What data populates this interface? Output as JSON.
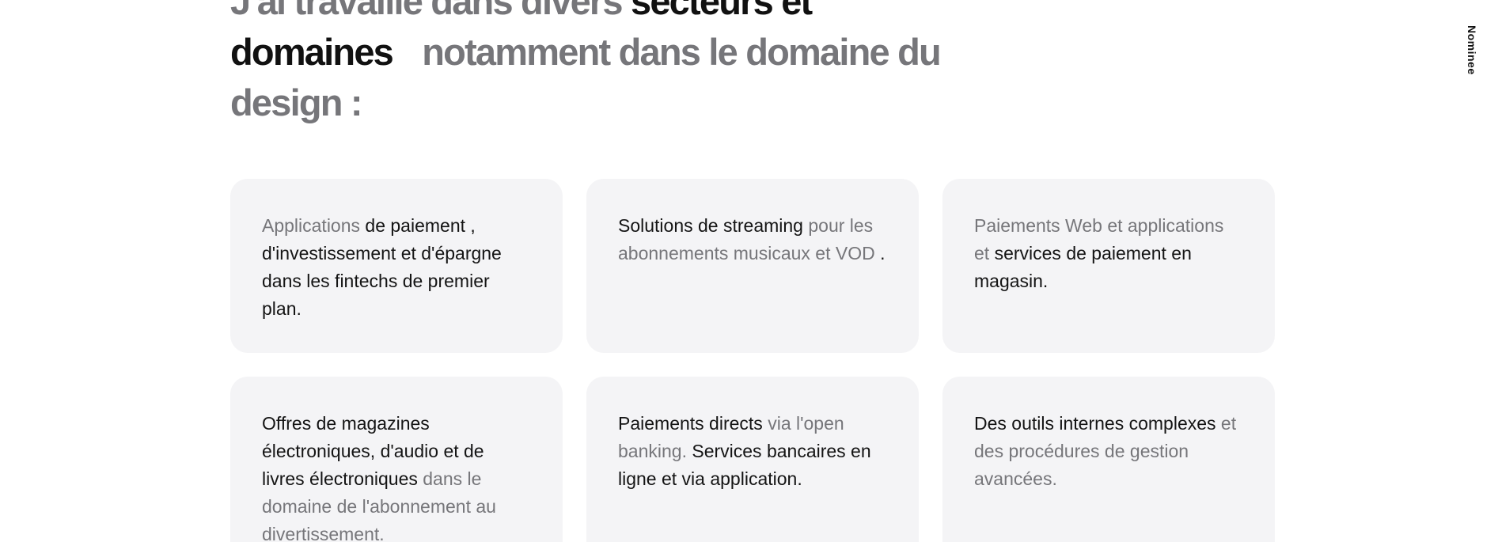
{
  "heading": {
    "part1_muted": "J'ai travaillé dans divers",
    "part2_dark": "secteurs et domaines",
    "part3_muted": "notamment dans le domaine du design :"
  },
  "side_label": "Nominee",
  "cards": [
    {
      "seg1_muted": "Applications",
      "seg2_dark": "de paiement , d'investissement et d'épargne dans les fintechs de premier plan."
    },
    {
      "seg1_dark": "Solutions de streaming",
      "seg2_muted": "pour les abonnements musicaux et VOD",
      "seg3_dark": "."
    },
    {
      "seg1_muted": "Paiements Web et applications et",
      "seg2_dark": "services de paiement en magasin."
    },
    {
      "seg1_dark": "Offres de magazines électroniques, d'audio et de livres électroniques",
      "seg2_muted": "dans le domaine de l'abonnement au divertissement."
    },
    {
      "seg1_dark": "Paiements directs",
      "seg2_muted": "via l'open banking.",
      "seg3_dark": "Services bancaires en ligne et via application."
    },
    {
      "seg1_dark": "Des outils internes complexes",
      "seg2_muted": "et des procédures de gestion avancées."
    }
  ]
}
